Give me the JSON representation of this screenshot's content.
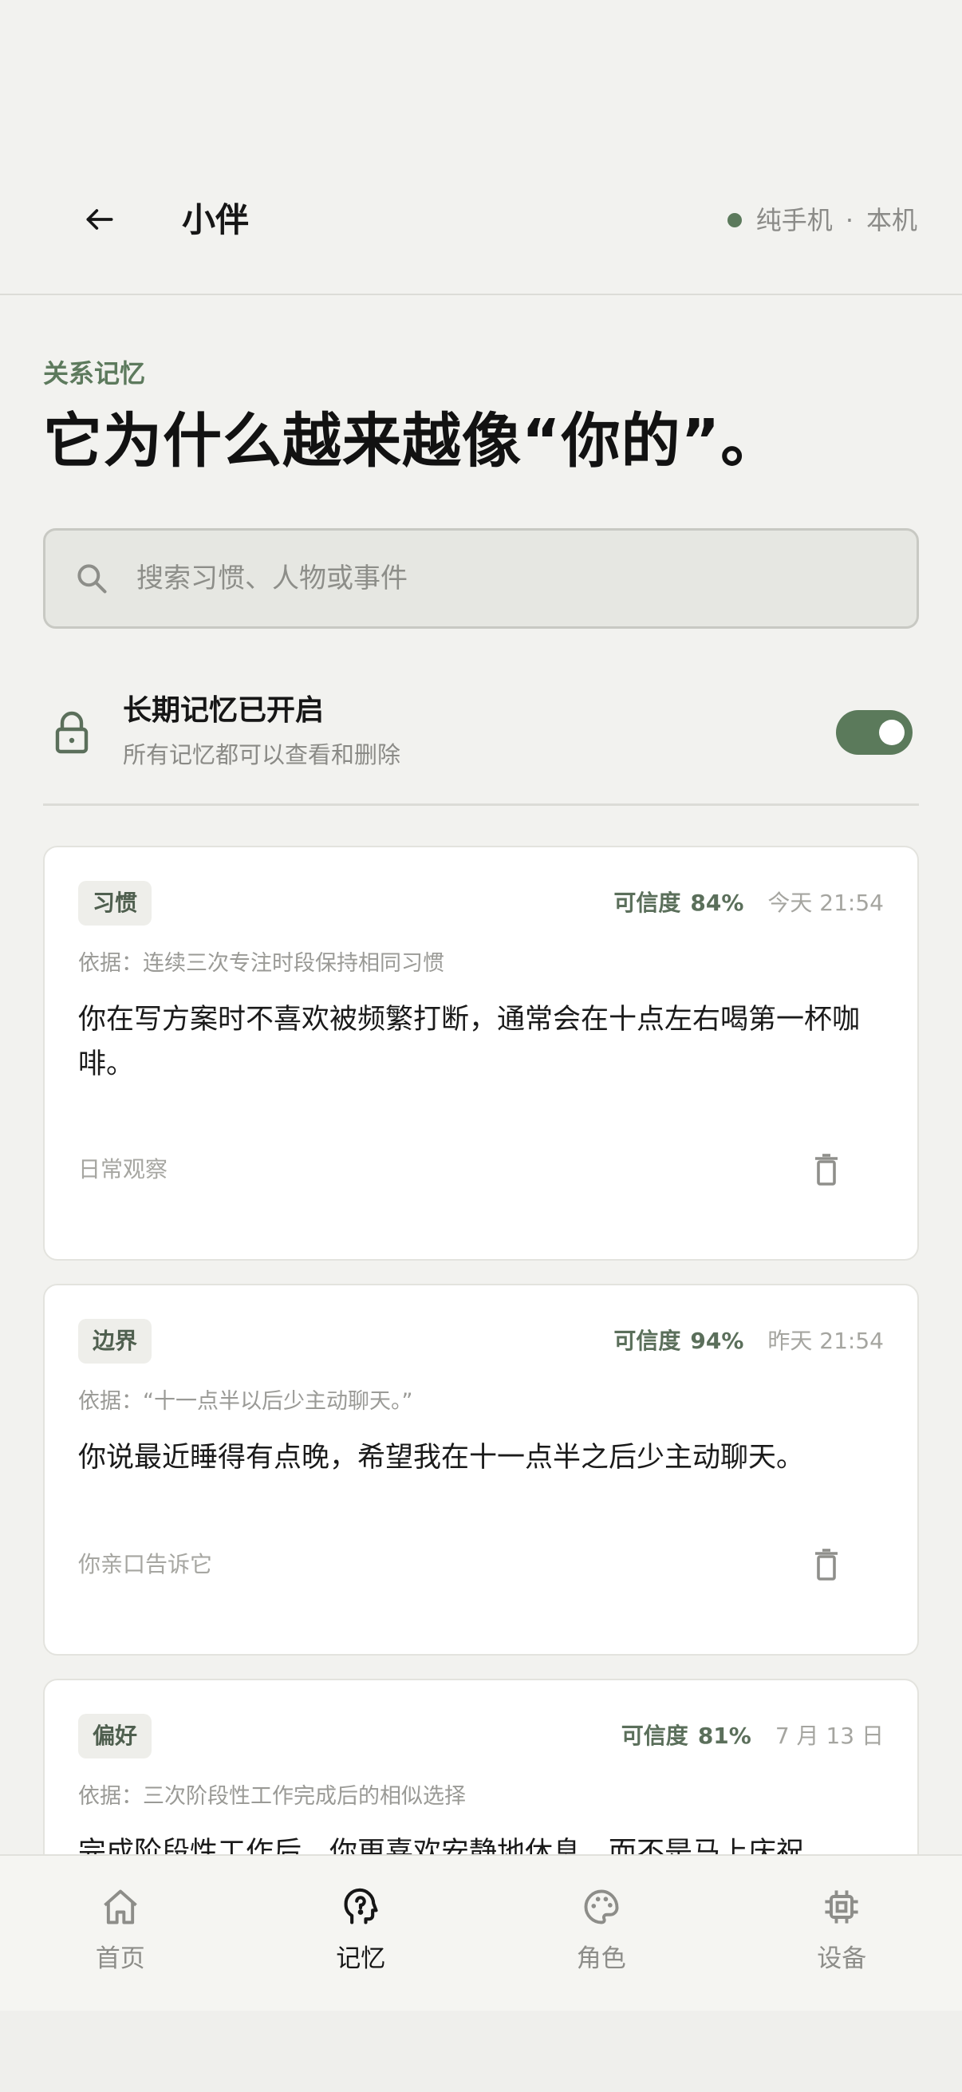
{
  "header": {
    "title": "小伴",
    "status": {
      "primary": "纯手机",
      "separator": "·",
      "secondary": "本机",
      "dot_color": "#5c7a5c"
    }
  },
  "intro": {
    "eyebrow": "关系记忆",
    "headline": "它为什么越来越像“你的”。"
  },
  "search": {
    "placeholder": "搜索习惯、人物或事件",
    "value": ""
  },
  "memory_setting": {
    "title": "长期记忆已开启",
    "subtitle": "所有记忆都可以查看和删除",
    "enabled": true
  },
  "cards": [
    {
      "tag": "习惯",
      "confidence_label": "可信度",
      "confidence": "84%",
      "time": "今天 21:54",
      "evidence": "依据：连续三次专注时段保持相同习惯",
      "text": "你在写方案时不喜欢被频繁打断，通常会在十点左右喝第一杯咖啡。",
      "source": "日常观察"
    },
    {
      "tag": "边界",
      "confidence_label": "可信度",
      "confidence": "94%",
      "time": "昨天 21:54",
      "evidence": "依据：“十一点半以后少主动聊天。”",
      "text": "你说最近睡得有点晚，希望我在十一点半之后少主动聊天。",
      "source": "你亲口告诉它"
    },
    {
      "tag": "偏好",
      "confidence_label": "可信度",
      "confidence": "81%",
      "time": "7 月 13 日",
      "evidence": "依据：三次阶段性工作完成后的相似选择",
      "text": "完成阶段性工作后，你更喜欢安静地休息，而不是马上庆祝。",
      "source": ""
    }
  ],
  "nav": {
    "items": [
      {
        "label": "首页",
        "icon": "home-icon",
        "active": false
      },
      {
        "label": "记忆",
        "icon": "memory-icon",
        "active": true
      },
      {
        "label": "角色",
        "icon": "palette-icon",
        "active": false
      },
      {
        "label": "设备",
        "icon": "chip-icon",
        "active": false
      }
    ]
  },
  "colors": {
    "accent": "#5b7a5b",
    "background": "#f2f2ef",
    "card": "#ffffff"
  }
}
